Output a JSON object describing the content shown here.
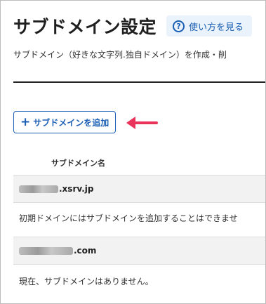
{
  "header": {
    "title": "サブドメイン設定",
    "help_button_label": "使い方を見る",
    "help_icon": "question-circle-icon"
  },
  "description": "サブドメイン（好きな文字列.独自ドメイン）を作成・削",
  "add_button": {
    "label": "サブドメインを追加",
    "icon": "plus-icon"
  },
  "annotation": {
    "arrow_color": "#e8345a"
  },
  "table": {
    "column_header": "サブドメイン名"
  },
  "domains": [
    {
      "visible_suffix": ".xsrv.jp",
      "note": "初期ドメインにはサブドメインを追加することはできませ"
    },
    {
      "visible_suffix": ".com",
      "note": "現在、サブドメインはありません。"
    }
  ],
  "colors": {
    "accent": "#1a5fb4",
    "help_background": "#eaf2fb",
    "row_background": "#f2f2f2"
  }
}
